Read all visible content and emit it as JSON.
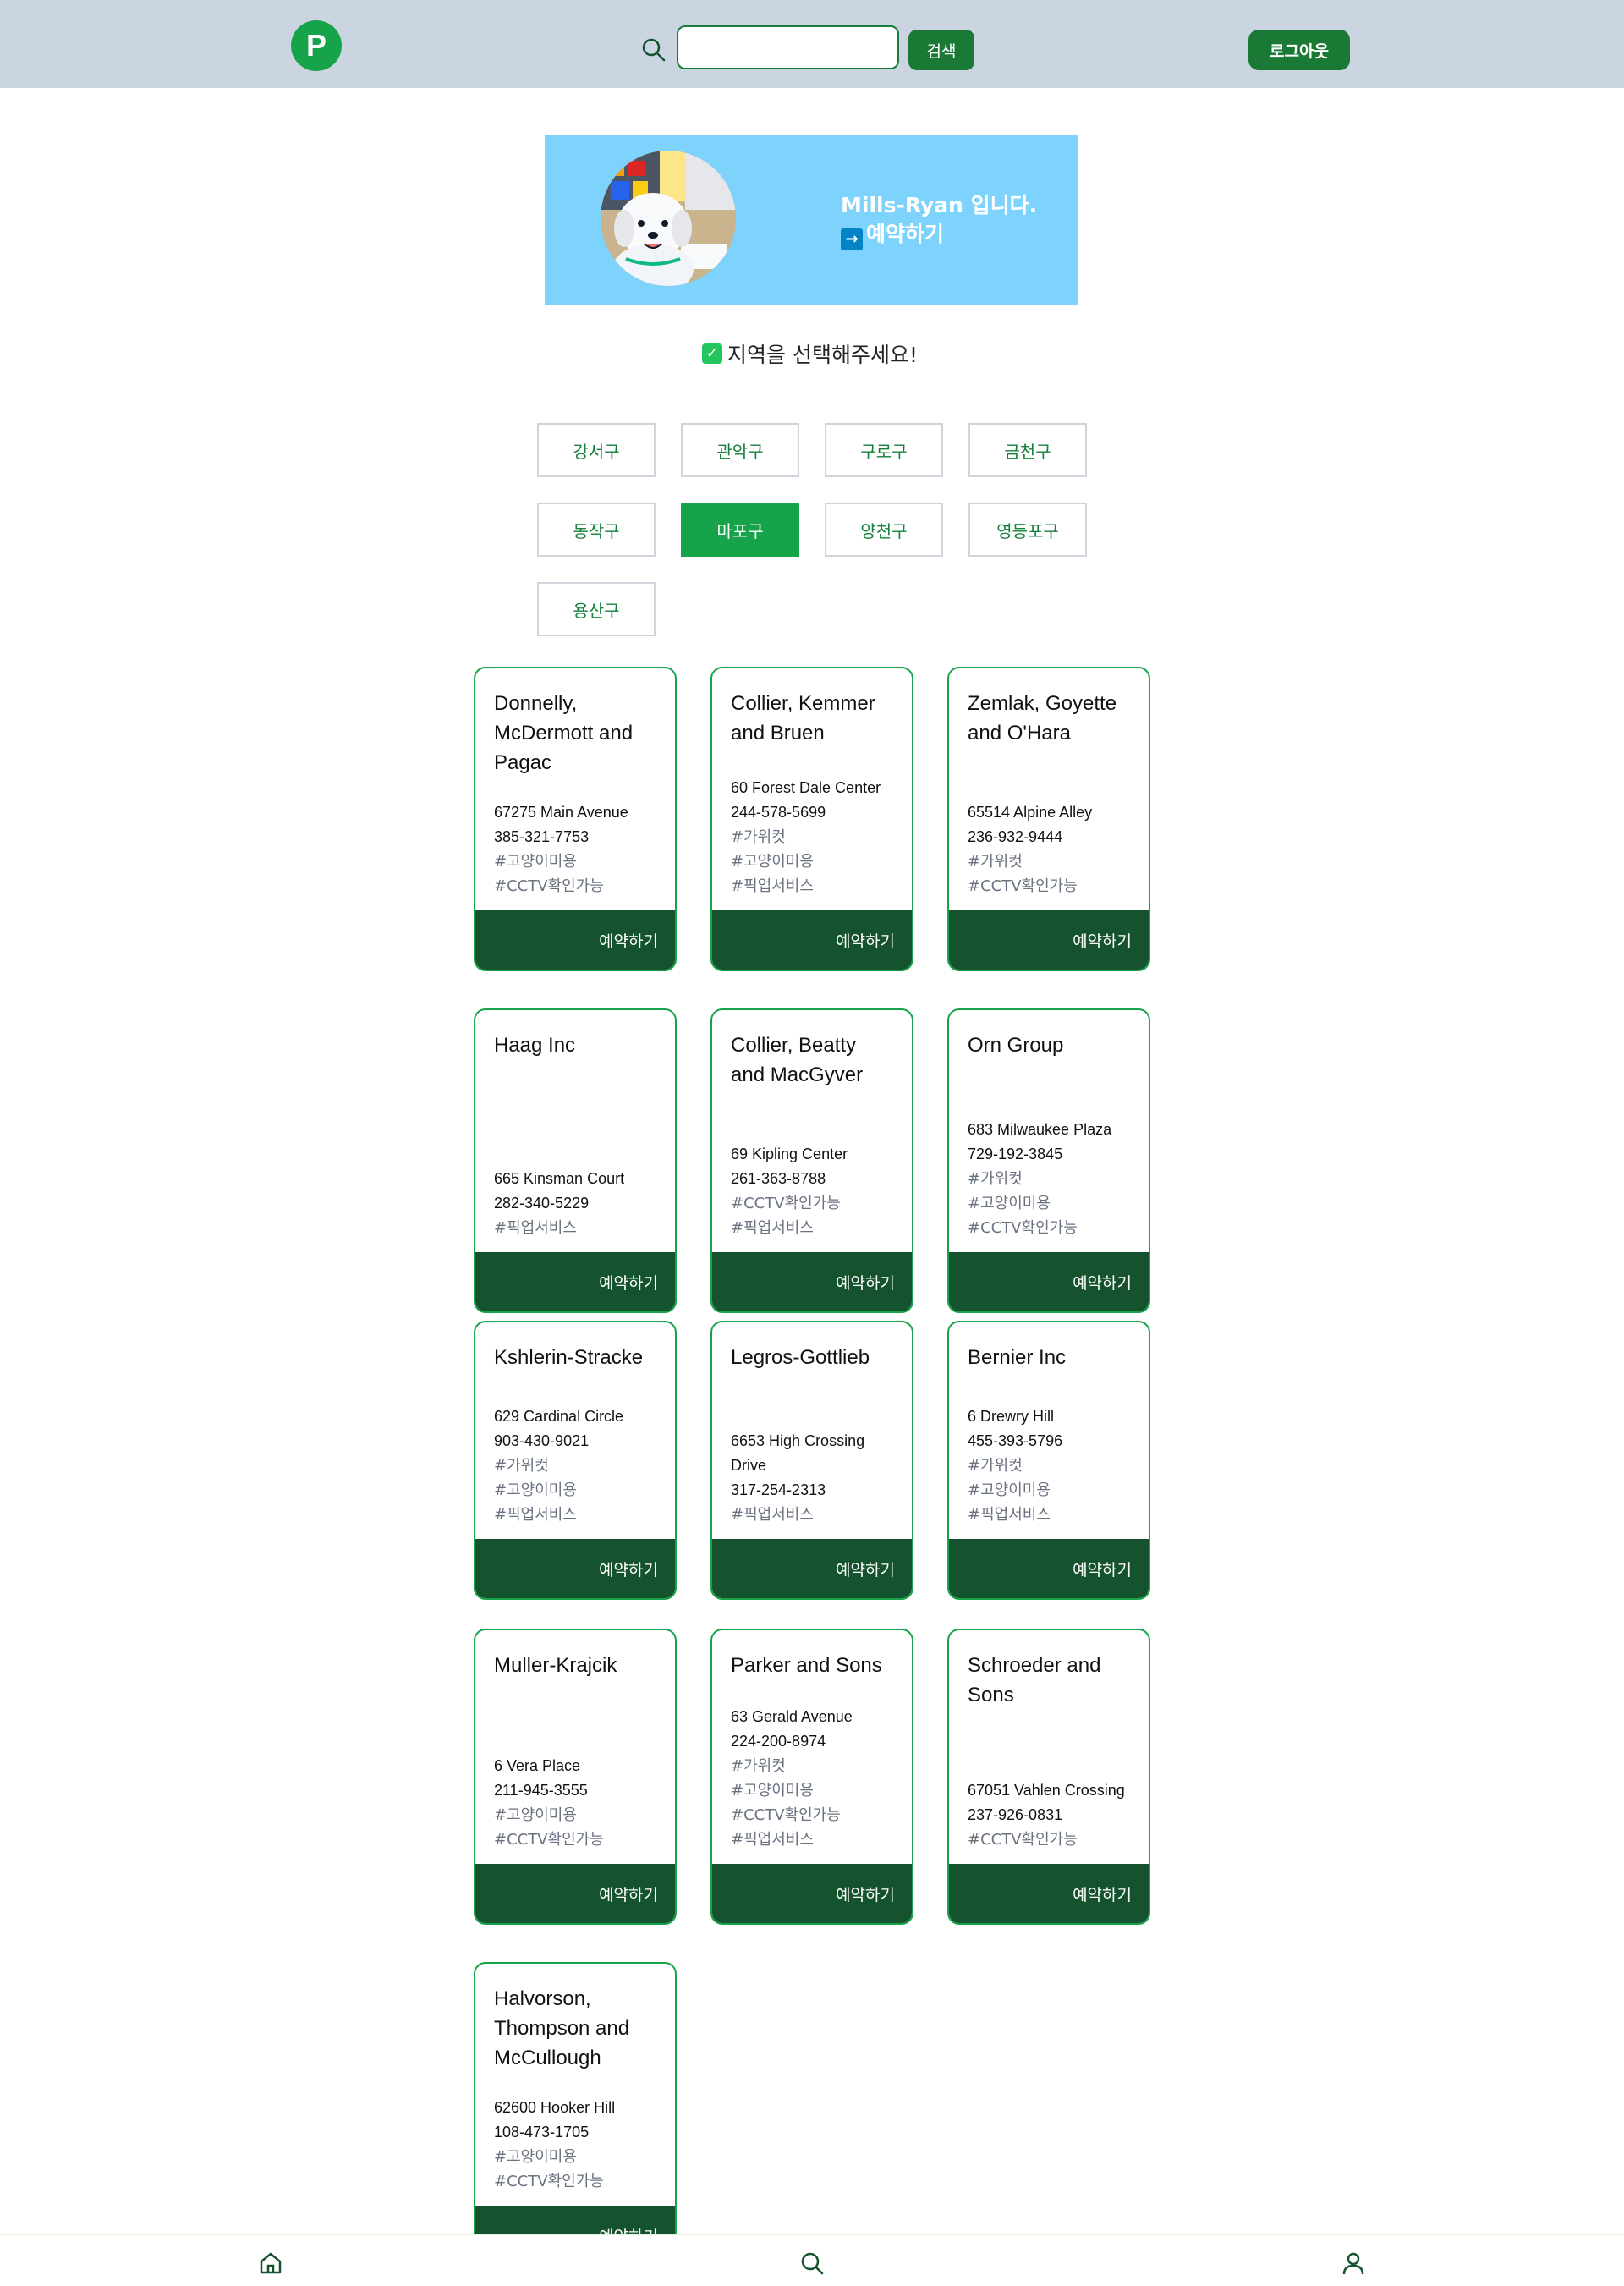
{
  "header": {
    "logo_letter": "P",
    "search_placeholder": "",
    "search_button": "검색",
    "logout_button": "로그아웃",
    "icons": [
      "search-icon"
    ]
  },
  "banner": {
    "greeting": "Mills-Ryan 입니다.",
    "reserve_arrow": "→",
    "reserve_link": "예약하기"
  },
  "region_prompt": "지역을 선택해주세요!",
  "regions": [
    {
      "label": "강서구",
      "active": false
    },
    {
      "label": "관악구",
      "active": false
    },
    {
      "label": "구로구",
      "active": false
    },
    {
      "label": "금천구",
      "active": false
    },
    {
      "label": "동작구",
      "active": false
    },
    {
      "label": "마포구",
      "active": true
    },
    {
      "label": "양천구",
      "active": false
    },
    {
      "label": "영등포구",
      "active": false
    },
    {
      "label": "용산구",
      "active": false
    }
  ],
  "reserve_label": "예약하기",
  "shops": [
    {
      "name": "Donnelly, McDermott and Pagac",
      "address": "67275 Main Avenue",
      "phone": "385-321-7753",
      "tags": [
        "#고양이미용",
        "#CCTV확인가능"
      ]
    },
    {
      "name": "Collier, Kemmer and Bruen",
      "address": "60 Forest Dale Center",
      "phone": "244-578-5699",
      "tags": [
        "#가위컷",
        "#고양이미용",
        "#픽업서비스"
      ]
    },
    {
      "name": "Zemlak, Goyette and O'Hara",
      "address": "65514 Alpine Alley",
      "phone": "236-932-9444",
      "tags": [
        "#가위컷",
        "#CCTV확인가능"
      ]
    },
    {
      "name": "Haag Inc",
      "address": "665 Kinsman Court",
      "phone": "282-340-5229",
      "tags": [
        "#픽업서비스"
      ]
    },
    {
      "name": "Collier, Beatty and MacGyver",
      "address": "69 Kipling Center",
      "phone": "261-363-8788",
      "tags": [
        "#CCTV확인가능",
        "#픽업서비스"
      ]
    },
    {
      "name": "Orn Group",
      "address": "683 Milwaukee Plaza",
      "phone": "729-192-3845",
      "tags": [
        "#가위컷",
        "#고양이미용",
        "#CCTV확인가능"
      ]
    },
    {
      "name": "Kshlerin-Stracke",
      "address": "629 Cardinal Circle",
      "phone": "903-430-9021",
      "tags": [
        "#가위컷",
        "#고양이미용",
        "#픽업서비스"
      ]
    },
    {
      "name": "Legros-Gottlieb",
      "address": "6653 High Crossing Drive",
      "phone": "317-254-2313",
      "tags": [
        "#픽업서비스"
      ]
    },
    {
      "name": "Bernier Inc",
      "address": "6 Drewry Hill",
      "phone": "455-393-5796",
      "tags": [
        "#가위컷",
        "#고양이미용",
        "#픽업서비스"
      ]
    },
    {
      "name": "Muller-Krajcik",
      "address": "6 Vera Place",
      "phone": "211-945-3555",
      "tags": [
        "#고양이미용",
        "#CCTV확인가능"
      ]
    },
    {
      "name": "Parker and Sons",
      "address": "63 Gerald Avenue",
      "phone": "224-200-8974",
      "tags": [
        "#가위컷",
        "#고양이미용",
        "#CCTV확인가능",
        "#픽업서비스"
      ]
    },
    {
      "name": "Schroeder and Sons",
      "address": "67051 Vahlen Crossing",
      "phone": "237-926-0831",
      "tags": [
        "#CCTV확인가능"
      ]
    },
    {
      "name": "Halvorson, Thompson and McCullough",
      "address": "62600 Hooker Hill",
      "phone": "108-473-1705",
      "tags": [
        "#고양이미용",
        "#CCTV확인가능"
      ]
    }
  ],
  "bottom_nav": {
    "items": [
      "home-icon",
      "search-icon",
      "user-icon"
    ]
  },
  "colors": {
    "header_bg": "#cbd5e1",
    "primary_green": "#16a34a",
    "dark_green": "#14532d",
    "banner_bg": "#7dd3fc"
  }
}
